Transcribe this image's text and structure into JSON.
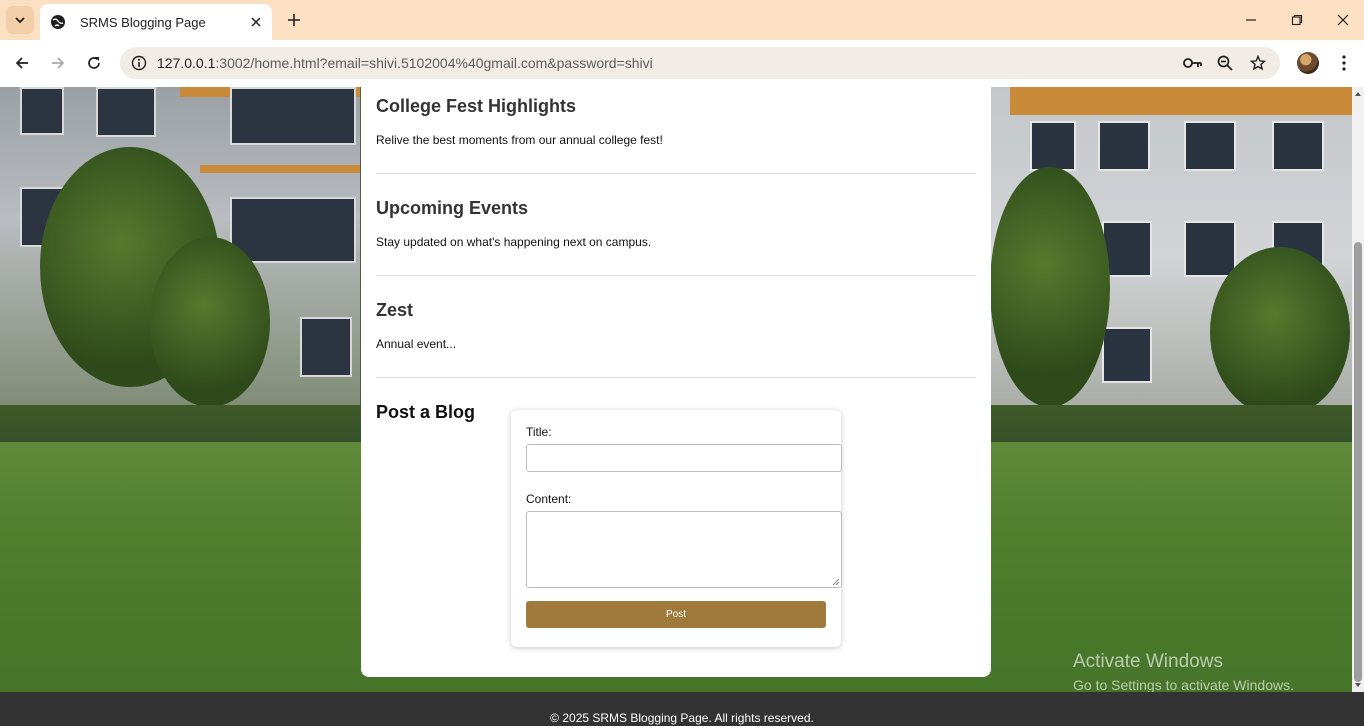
{
  "browser": {
    "tab_title": "SRMS Blogging Page",
    "url_host": "127.0.0.1",
    "url_rest": ":3002/home.html?email=shivi.5102004%40gmail.com&password=shivi",
    "icons": [
      "tab-list-icon",
      "globe-icon",
      "close-icon",
      "plus-icon",
      "minimize-icon",
      "restore-icon",
      "close-window-icon",
      "back-arrow-icon",
      "forward-arrow-icon",
      "reload-icon",
      "site-info-icon",
      "key-icon",
      "zoom-icon",
      "star-icon",
      "kebab-menu-icon"
    ]
  },
  "posts": [
    {
      "title": "College Fest Highlights",
      "text": "Relive the best moments from our annual college fest!"
    },
    {
      "title": "Upcoming Events",
      "text": "Stay updated on what's happening next on campus."
    },
    {
      "title": "Zest",
      "text": "Annual event..."
    }
  ],
  "form": {
    "heading": "Post a Blog",
    "title_label": "Title:",
    "title_value": "",
    "content_label": "Content:",
    "content_value": "",
    "submit_label": "Post"
  },
  "footer": {
    "text": "© 2025 SRMS Blogging Page. All rights reserved."
  },
  "watermark": {
    "line1": "Activate Windows",
    "line2": "Go to Settings to activate Windows."
  },
  "colors": {
    "accent": "#a07a3c",
    "tab_strip": "#fbe0c4",
    "footer_bg": "#333333"
  }
}
